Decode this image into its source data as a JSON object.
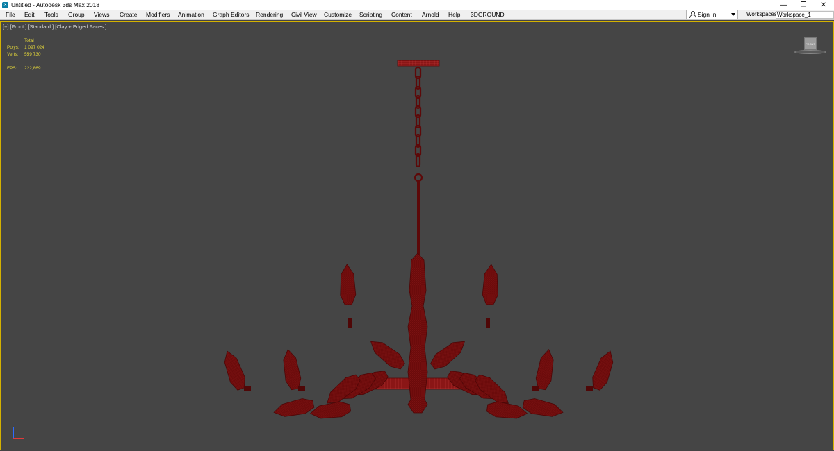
{
  "window": {
    "title": "Untitled - Autodesk 3ds Max 2018",
    "app_icon": "3",
    "minimize": "—",
    "maximize": "❐",
    "close": "✕"
  },
  "menu": {
    "items": [
      "File",
      "Edit",
      "Tools",
      "Group",
      "Views",
      "Create",
      "Modifiers",
      "Animation",
      "Graph Editors",
      "Rendering",
      "Civil View",
      "Customize",
      "Scripting",
      "Content",
      "Arnold",
      "Help",
      "3DGROUND"
    ],
    "sign_in": "Sign In",
    "workspaces_label": "Workspaces:",
    "workspace_value": "Workspace_1"
  },
  "viewport": {
    "label": "[+] [Front ] [Standard ] [Clay + Edged Faces ]",
    "stats": {
      "header": "Total",
      "polys_label": "Polys:",
      "polys_value": "1 097 024",
      "verts_label": "Verts:",
      "verts_value": "559 730",
      "fps_label": "FPS:",
      "fps_value": "222,869"
    },
    "viewcube_label": "FRONT"
  },
  "colors": {
    "viewport_bg": "#454545",
    "viewport_border": "#d4b100",
    "model_fill": "#6b0b0b",
    "model_edge": "#a01818",
    "stats_text": "#e6d83a"
  }
}
